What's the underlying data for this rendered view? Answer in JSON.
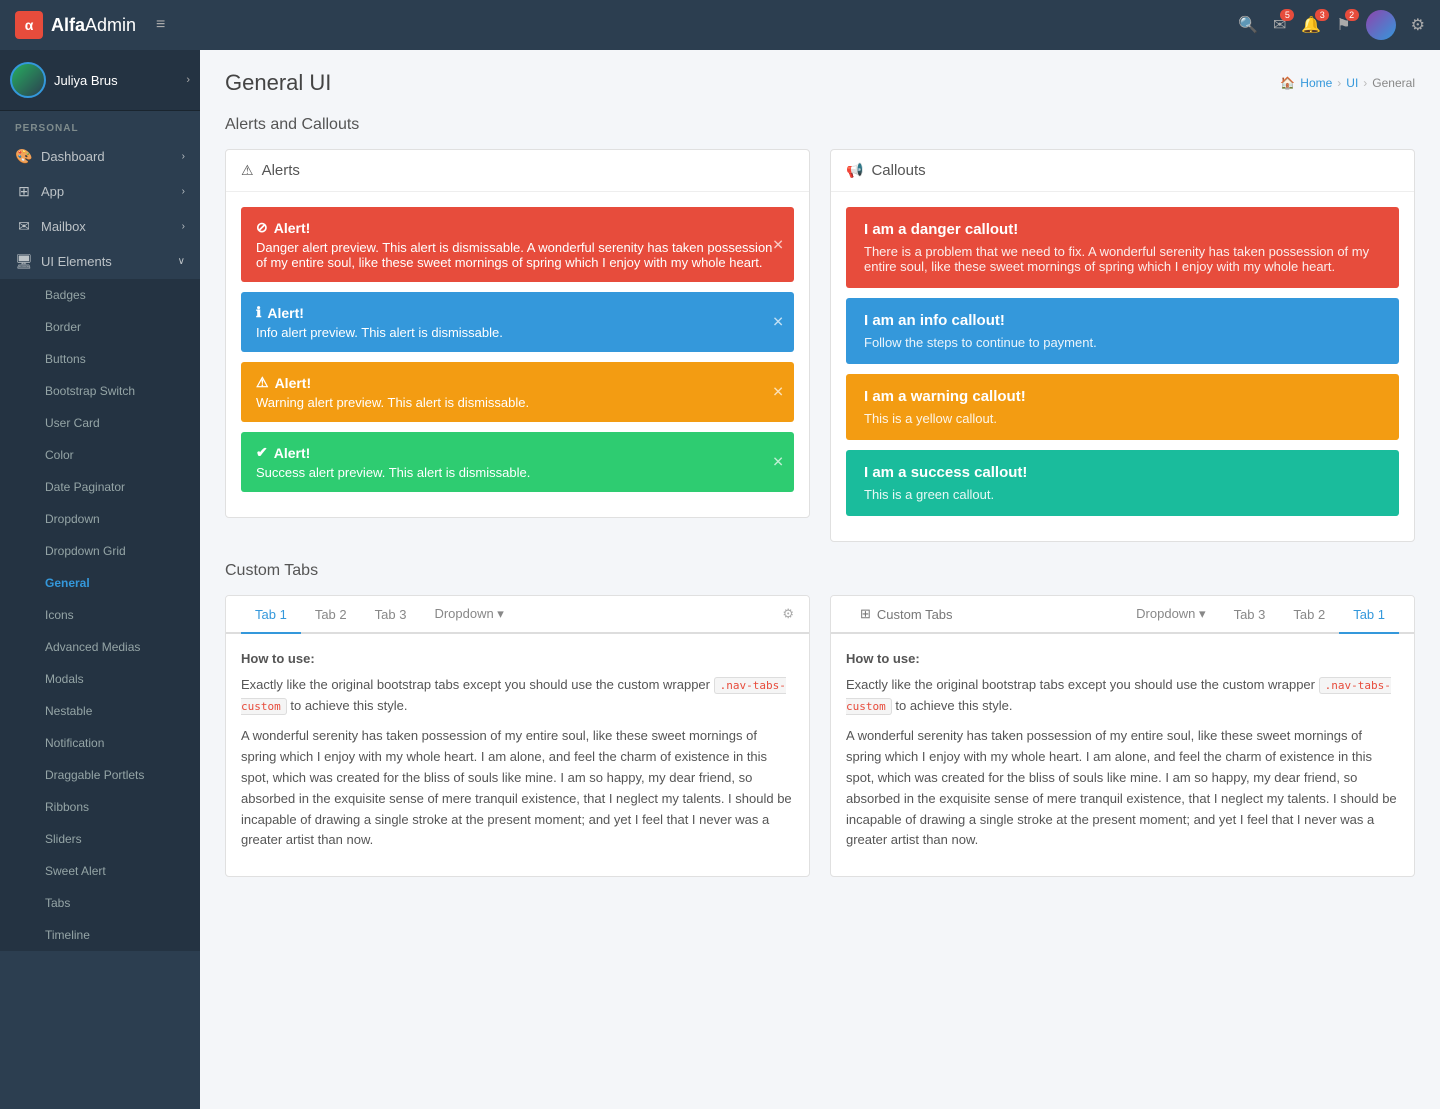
{
  "app": {
    "brand": "AlfaAdmin",
    "brand_bold": "Alfa",
    "brand_light": "Admin"
  },
  "navbar": {
    "toggle_icon": "≡",
    "search_icon": "🔍",
    "email_icon": "✉",
    "email_badge": "5",
    "bell_icon": "🔔",
    "bell_badge": "3",
    "flag_icon": "⚑",
    "flag_badge": "2",
    "gear_icon": "⚙"
  },
  "sidebar": {
    "user_name": "Juliya Brus",
    "section_personal": "PERSONAL",
    "items": [
      {
        "id": "dashboard",
        "label": "Dashboard",
        "icon": "🎨",
        "has_arrow": true
      },
      {
        "id": "app",
        "label": "App",
        "icon": "⊞",
        "has_arrow": true
      },
      {
        "id": "mailbox",
        "label": "Mailbox",
        "icon": "✉",
        "has_arrow": true
      },
      {
        "id": "ui-elements",
        "label": "UI Elements",
        "icon": "🖥",
        "has_arrow": true,
        "expanded": true
      }
    ],
    "submenu": [
      "Badges",
      "Border",
      "Buttons",
      "Bootstrap Switch",
      "User Card",
      "Color",
      "Date Paginator",
      "Dropdown",
      "Dropdown Grid",
      "General",
      "Icons",
      "Advanced Medias",
      "Modals",
      "Nestable",
      "Notification",
      "Draggable Portlets",
      "Ribbons",
      "Sliders",
      "Sweet Alert",
      "Tabs",
      "Timeline"
    ]
  },
  "page": {
    "title": "General UI",
    "breadcrumb": [
      "Home",
      "UI",
      "General"
    ]
  },
  "alerts_section": {
    "title": "Alerts and Callouts"
  },
  "alerts_panel": {
    "header_icon": "⚠",
    "header_title": "Alerts",
    "items": [
      {
        "type": "danger",
        "icon": "⊘",
        "title": "Alert!",
        "text": "Danger alert preview. This alert is dismissable. A wonderful serenity has taken possession of my entire soul, like these sweet mornings of spring which I enjoy with my whole heart."
      },
      {
        "type": "info",
        "icon": "ℹ",
        "title": "Alert!",
        "text": "Info alert preview. This alert is dismissable."
      },
      {
        "type": "warning",
        "icon": "⚠",
        "title": "Alert!",
        "text": "Warning alert preview. This alert is dismissable."
      },
      {
        "type": "success",
        "icon": "✔",
        "title": "Alert!",
        "text": "Success alert preview. This alert is dismissable."
      }
    ]
  },
  "callouts_panel": {
    "header_icon": "📢",
    "header_title": "Callouts",
    "items": [
      {
        "type": "danger",
        "title": "I am a danger callout!",
        "text": "There is a problem that we need to fix. A wonderful serenity has taken possession of my entire soul, like these sweet mornings of spring which I enjoy with my whole heart."
      },
      {
        "type": "info",
        "title": "I am an info callout!",
        "text": "Follow the steps to continue to payment."
      },
      {
        "type": "warning",
        "title": "I am a warning callout!",
        "text": "This is a yellow callout."
      },
      {
        "type": "success",
        "title": "I am a success callout!",
        "text": "This is a green callout."
      }
    ]
  },
  "tabs_section": {
    "title": "Custom Tabs"
  },
  "tabs_left_panel": {
    "tabs": [
      "Tab 1",
      "Tab 2",
      "Tab 3",
      "Dropdown ▾"
    ],
    "active_tab": "Tab 1",
    "how_to_label": "How to use:",
    "how_to_line1": "Exactly like the original bootstrap tabs except you should use the custom wrapper",
    "nav_tag": ".nav-tabs-custom",
    "how_to_line2": "to achieve this style.",
    "body_text": "A wonderful serenity has taken possession of my entire soul, like these sweet mornings of spring which I enjoy with my whole heart. I am alone, and feel the charm of existence in this spot, which was created for the bliss of souls like mine. I am so happy, my dear friend, so absorbed in the exquisite sense of mere tranquil existence, that I neglect my talents. I should be incapable of drawing a single stroke at the present moment; and yet I feel that I never was a greater artist than now."
  },
  "tabs_right_panel": {
    "tabs": [
      "Dropdown ▾",
      "Tab 3",
      "Tab 2",
      "Tab 1"
    ],
    "active_tab": "Tab 1",
    "how_to_label": "How to use:",
    "how_to_line1": "Exactly like the original bootstrap tabs except you should use the custom wrapper",
    "nav_tag": ".nav-tabs-custom",
    "how_to_line2": "to achieve this style.",
    "body_text": "A wonderful serenity has taken possession of my entire soul, like these sweet mornings of spring which I enjoy with my whole heart. I am alone, and feel the charm of existence in this spot, which was created for the bliss of souls like mine. I am so happy, my dear friend, so absorbed in the exquisite sense of mere tranquil existence, that I neglect my talents. I should be incapable of drawing a single stroke at the present moment; and yet I feel that I never was a greater artist than now."
  },
  "colors": {
    "danger": "#e74c3c",
    "info": "#3498db",
    "warning": "#f39c12",
    "success": "#2ecc71",
    "success_callout": "#1abc9c",
    "sidebar_bg": "#2c3e50",
    "active_tab": "#3498db"
  }
}
